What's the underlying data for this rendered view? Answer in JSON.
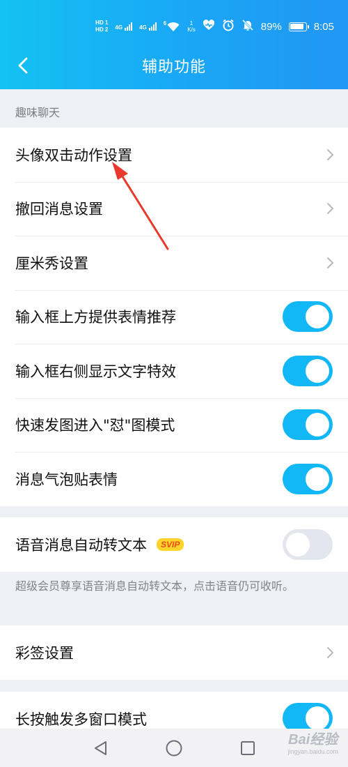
{
  "status_bar": {
    "hd1": "HD 1",
    "hd2": "HD 2",
    "net1": "4G",
    "net2": "4G",
    "wifi_label": "6",
    "speed_value": "1",
    "speed_unit": "K/s",
    "battery": "89%",
    "time": "8:05",
    "icons": [
      "signal-icon",
      "wifi-icon",
      "heart-icon",
      "alarm-icon",
      "mute-icon",
      "battery-icon"
    ]
  },
  "header": {
    "title": "辅助功能"
  },
  "sections": {
    "fun_chat": "趣味聊天"
  },
  "rows": {
    "avatar_double_tap": "头像双击动作设置",
    "recall_message": "撤回消息设置",
    "cmshow": "厘米秀设置",
    "emoji_suggest": "输入框上方提供表情推荐",
    "text_effects": "输入框右侧显示文字特效",
    "quick_image": "快速发图进入\"怼\"图模式",
    "bubble_stickers": "消息气泡贴表情",
    "voice_to_text": "语音消息自动转文本",
    "svip_badge": "SVIP",
    "voice_note": "超级会员尊享语音消息自动转文本，点击语音仍可收听。",
    "colored_tag": "彩签设置",
    "multi_window": "长按触发多窗口模式"
  },
  "toggles": {
    "emoji_suggest": true,
    "text_effects": true,
    "quick_image": true,
    "bubble_stickers": true,
    "voice_to_text": false,
    "multi_window": true
  },
  "watermark": {
    "main": "Bai经验",
    "sub": "jingyan.baidu.com"
  },
  "colors": {
    "accent": "#12b7f5",
    "annotation_arrow": "#e8392c",
    "svip_bg": "#ffd42a"
  }
}
